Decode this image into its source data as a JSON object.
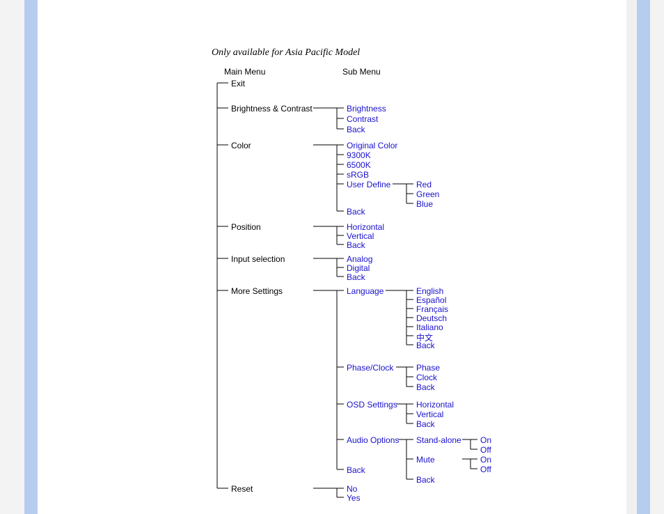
{
  "title": "Only available for Asia Pacific Model",
  "headers": {
    "main": "Main Menu",
    "sub": "Sub Menu"
  },
  "main": {
    "exit": "Exit",
    "brightness_contrast": "Brightness & Contrast",
    "color": "Color",
    "position": "Position",
    "input_selection": "Input selection",
    "more_settings": "More Settings",
    "reset": "Reset"
  },
  "sub": {
    "brightness": "Brightness",
    "contrast": "Contrast",
    "back": "Back",
    "original_color": "Original Color",
    "k9300": "9300K",
    "k6500": "6500K",
    "srgb": "sRGB",
    "user_define": "User Define",
    "red": "Red",
    "green": "Green",
    "blue": "Blue",
    "horizontal": "Horizontal",
    "vertical": "Vertical",
    "analog": "Analog",
    "digital": "Digital",
    "language": "Language",
    "english": "English",
    "espanol": "Español",
    "francais": "Français",
    "deutsch": "Deutsch",
    "italiano": "Italiano",
    "chinese": "中文",
    "phase_clock": "Phase/Clock",
    "phase": "Phase",
    "clock": "Clock",
    "osd_settings": "OSD Settings",
    "audio_options": "Audio Options",
    "stand_alone": "Stand-alone",
    "mute": "Mute",
    "on": "On",
    "off": "Off",
    "no": "No",
    "yes": "Yes"
  }
}
